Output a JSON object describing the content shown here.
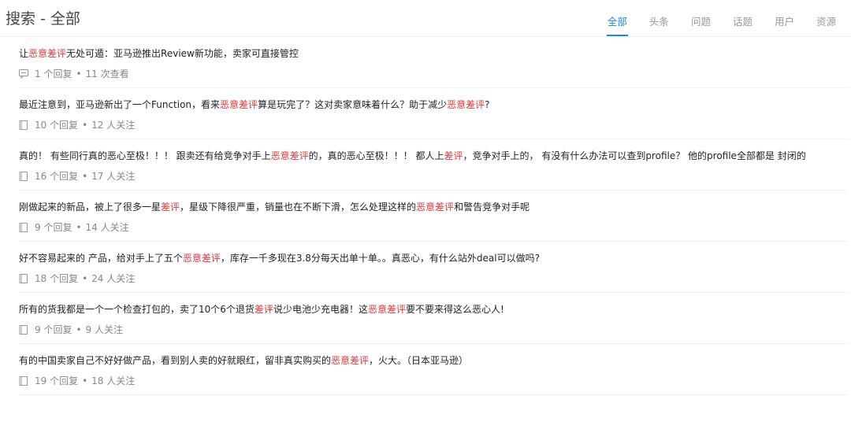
{
  "header": {
    "title": "搜索 - 全部",
    "tabs": [
      {
        "label": "全部",
        "active": true
      },
      {
        "label": "头条",
        "active": false
      },
      {
        "label": "问题",
        "active": false
      },
      {
        "label": "话题",
        "active": false
      },
      {
        "label": "用户",
        "active": false
      },
      {
        "label": "资源",
        "active": false
      }
    ]
  },
  "colors": {
    "accent": "#1e88e5",
    "highlight": "#e5383b"
  },
  "results": [
    {
      "segments": [
        {
          "text": "让"
        },
        {
          "text": "恶意差评",
          "hl": true
        },
        {
          "text": "无处可遁：亚马逊推出Review新功能，卖家可直接管控"
        }
      ],
      "icon": "comment-icon",
      "replies": "1 个回复",
      "separator": "•",
      "stat": "11 次查看"
    },
    {
      "segments": [
        {
          "text": "最近注意到，亚马逊新出了一个Function，看来"
        },
        {
          "text": "恶意差评",
          "hl": true
        },
        {
          "text": "算是玩完了？这对卖家意味着什么？助于减少"
        },
        {
          "text": "恶意差评",
          "hl": true
        },
        {
          "text": "?"
        }
      ],
      "icon": "question-icon",
      "replies": "10 个回复",
      "separator": "•",
      "stat": "12 人关注"
    },
    {
      "segments": [
        {
          "text": "真的！ 有些同行真的恶心至极！！！ 跟卖还有给竞争对手上"
        },
        {
          "text": "恶意差评",
          "hl": true
        },
        {
          "text": "的，真的恶心至极！！！ 都人上"
        },
        {
          "text": "差评",
          "hl": true
        },
        {
          "text": "，竞争对手上的， 有没有什么办法可以查到profile？ 他的profile全部都是 封闭的"
        }
      ],
      "icon": "question-icon",
      "replies": "16 个回复",
      "separator": "•",
      "stat": "17 人关注"
    },
    {
      "segments": [
        {
          "text": "刚做起来的新品，被上了很多一星"
        },
        {
          "text": "差评",
          "hl": true
        },
        {
          "text": "，星级下降很严重，销量也在不断下滑，怎么处理这样的"
        },
        {
          "text": "恶意差评",
          "hl": true
        },
        {
          "text": "和警告竞争对手呢"
        }
      ],
      "icon": "question-icon",
      "replies": "9 个回复",
      "separator": "•",
      "stat": "14 人关注"
    },
    {
      "segments": [
        {
          "text": "好不容易起来的 产品，给对手上了五个"
        },
        {
          "text": "恶意差评",
          "hl": true
        },
        {
          "text": "，库存一千多现在3.8分每天出单十单。。真恶心，有什么站外deal可以做吗?"
        }
      ],
      "icon": "question-icon",
      "replies": "18 个回复",
      "separator": "•",
      "stat": "24 人关注"
    },
    {
      "segments": [
        {
          "text": "所有的货我都是一个一个检查打包的，卖了10个6个退货"
        },
        {
          "text": "差评",
          "hl": true
        },
        {
          "text": "说少电池少充电器！这"
        },
        {
          "text": "恶意差评",
          "hl": true
        },
        {
          "text": "要不要来得这么恶心人!"
        }
      ],
      "icon": "question-icon",
      "replies": "9 个回复",
      "separator": "•",
      "stat": "9 人关注"
    },
    {
      "segments": [
        {
          "text": "有的中国卖家自己不好好做产品，看到别人卖的好就眼红，留非真实购买的"
        },
        {
          "text": "恶意差评",
          "hl": true
        },
        {
          "text": "，火大。（日本亚马逊）"
        }
      ],
      "icon": "question-icon",
      "replies": "19 个回复",
      "separator": "•",
      "stat": "18 人关注"
    }
  ]
}
